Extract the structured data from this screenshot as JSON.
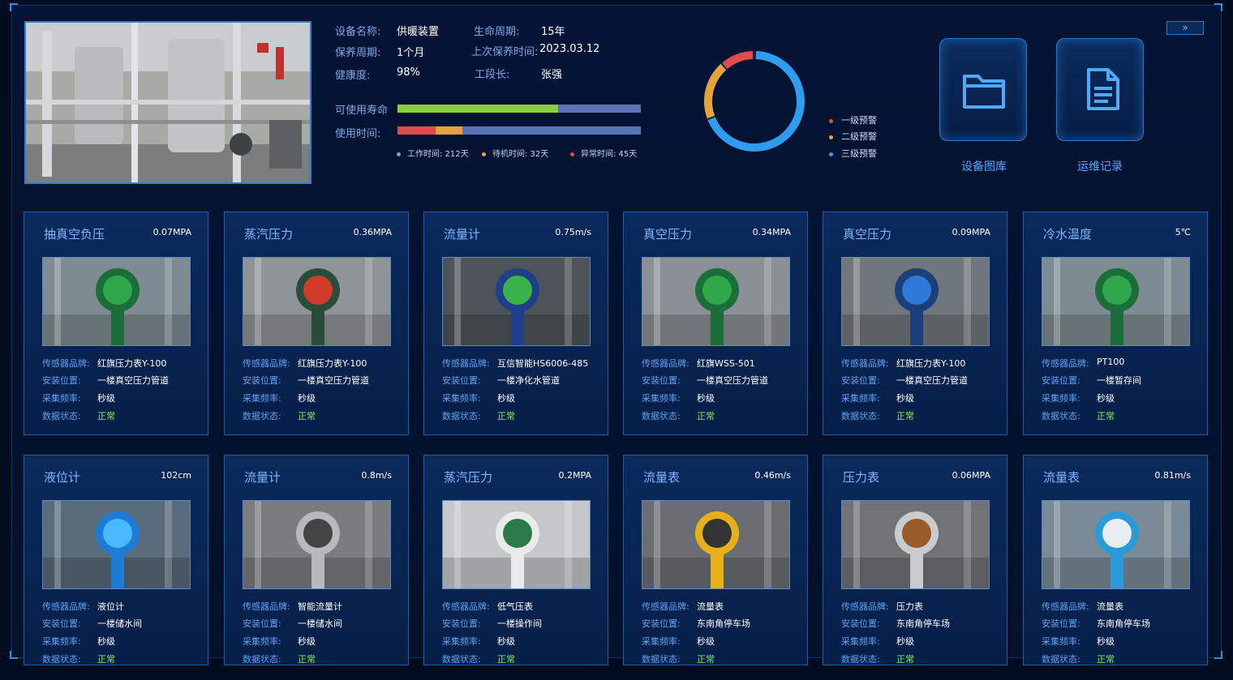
{
  "expand_icon": "»",
  "device": {
    "fields": [
      {
        "label": "设备名称:",
        "value": "供暖装置"
      },
      {
        "label": "保养周期:",
        "value": "1个月"
      },
      {
        "label": "健康度:",
        "value": "98%"
      },
      {
        "label": "生命周期:",
        "value": "15年"
      },
      {
        "label": "上次保养时间:",
        "value": "2023.03.12"
      },
      {
        "label": "工段长:",
        "value": "张强"
      }
    ],
    "usable_life_label": "可使用寿命",
    "usable_life_fraction": 0.66,
    "usage_time_label": "使用时间:",
    "usage_legend": [
      {
        "text": "工作时间: 212天",
        "color": "#5a72b8",
        "days": 212
      },
      {
        "text": "待机时间: 32天",
        "color": "#e6a23c",
        "days": 32
      },
      {
        "text": "异常时间: 45天",
        "color": "#e14b4b",
        "days": 45
      }
    ]
  },
  "alarms": {
    "items": [
      {
        "label": "一级预警",
        "color": "#e14b4b"
      },
      {
        "label": "二级预警",
        "color": "#e6a23c"
      },
      {
        "label": "三级预警",
        "color": "#2f9cf0"
      }
    ]
  },
  "nav": {
    "gallery_label": "设备图库",
    "records_label": "运维记录"
  },
  "field_labels": {
    "brand": "传感器品牌:",
    "location": "安装位置:",
    "frequency": "采集频率:",
    "status": "数据状态:"
  },
  "sensors": [
    {
      "title": "抽真空负压",
      "reading": "0.07MPA",
      "brand": "红旗压力表Y-100",
      "location": "一楼真空压力管道",
      "frequency": "秒级",
      "status": "正常"
    },
    {
      "title": "蒸汽压力",
      "reading": "0.36MPA",
      "brand": "红旗压力表Y-100",
      "location": "一楼真空压力管道",
      "frequency": "秒级",
      "status": "正常"
    },
    {
      "title": "流量计",
      "reading": "0.75m/s",
      "brand": "互信智能HS6006-485",
      "location": "一楼净化水管道",
      "frequency": "秒级",
      "status": "正常"
    },
    {
      "title": "真空压力",
      "reading": "0.34MPA",
      "brand": "红旗WSS-501",
      "location": "一楼真空压力管道",
      "frequency": "秒级",
      "status": "正常"
    },
    {
      "title": "真空压力",
      "reading": "0.09MPA",
      "brand": "红旗压力表Y-100",
      "location": "一楼真空压力管道",
      "frequency": "秒级",
      "status": "正常"
    },
    {
      "title": "冷水温度",
      "reading": "5℃",
      "brand": "PT100",
      "location": "一楼暂存间",
      "frequency": "秒级",
      "status": "正常"
    },
    {
      "title": "液位计",
      "reading": "102cm",
      "brand": "液位计",
      "location": "一楼储水间",
      "frequency": "秒级",
      "status": "正常"
    },
    {
      "title": "流量计",
      "reading": "0.8m/s",
      "brand": "智能流量计",
      "location": "一楼储水间",
      "frequency": "秒级",
      "status": "正常"
    },
    {
      "title": "蒸汽压力",
      "reading": "0.2MPA",
      "brand": "低气压表",
      "location": "一楼操作间",
      "frequency": "秒级",
      "status": "正常"
    },
    {
      "title": "流量表",
      "reading": "0.46m/s",
      "brand": "流量表",
      "location": "东南角停车场",
      "frequency": "秒级",
      "status": "正常"
    },
    {
      "title": "压力表",
      "reading": "0.06MPA",
      "brand": "压力表",
      "location": "东南角停车场",
      "frequency": "秒级",
      "status": "正常"
    },
    {
      "title": "流量表",
      "reading": "0.81m/s",
      "brand": "流量表",
      "location": "东南角停车场",
      "frequency": "秒级",
      "status": "正常"
    }
  ]
}
